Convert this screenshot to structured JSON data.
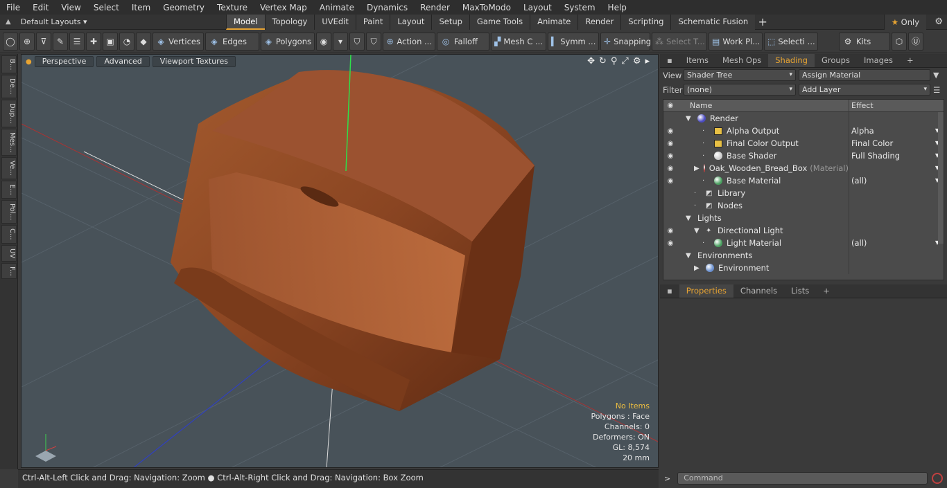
{
  "menu": [
    "File",
    "Edit",
    "View",
    "Select",
    "Item",
    "Geometry",
    "Texture",
    "Vertex Map",
    "Animate",
    "Dynamics",
    "Render",
    "MaxToModo",
    "Layout",
    "System",
    "Help"
  ],
  "layouts": {
    "label": "Default Layouts",
    "tabs": [
      "Model",
      "Topology",
      "UVEdit",
      "Paint",
      "Layout",
      "Setup",
      "Game Tools",
      "Animate",
      "Render",
      "Scripting",
      "Schematic Fusion"
    ],
    "active": "Model",
    "only": "Only"
  },
  "toolbar": {
    "vertices": "Vertices",
    "edges": "Edges",
    "polygons": "Polygons",
    "action": "Action ...",
    "falloff": "Falloff",
    "mesh": "Mesh C ...",
    "symm": "Symm ...",
    "snapping": "Snapping",
    "select_t": "Select T...",
    "workpl": "Work Pl...",
    "selecti": "Selecti ...",
    "kits": "Kits"
  },
  "lefttabs": [
    "B...",
    "De...",
    "Dup...",
    "Mes...",
    "Ve...",
    "E...",
    "Pol...",
    "C...",
    "UV",
    "F..."
  ],
  "viewport": {
    "perspective": "Perspective",
    "advanced": "Advanced",
    "textures": "Viewport Textures",
    "stats": {
      "items": "No Items",
      "polygons": "Polygons : Face",
      "channels": "Channels: 0",
      "deformers": "Deformers: ON",
      "gl": "GL: 8,574",
      "size": "20 mm"
    }
  },
  "status": "Ctrl-Alt-Left Click and Drag: Navigation: Zoom ● Ctrl-Alt-Right Click and Drag: Navigation: Box Zoom",
  "rpanel": {
    "tabs": [
      "Items",
      "Mesh Ops",
      "Shading",
      "Groups",
      "Images"
    ],
    "active": "Shading",
    "view_label": "View",
    "view_value": "Shader Tree",
    "assign": "Assign Material",
    "filter_label": "Filter",
    "filter_value": "(none)",
    "add_layer": "Add Layer",
    "col_name": "Name",
    "col_effect": "Effect",
    "rows": [
      {
        "name": "Render",
        "effect": "",
        "indent": 0,
        "eye": false,
        "icon": "render-ball",
        "exp": "▼"
      },
      {
        "name": "Alpha Output",
        "effect": "Alpha",
        "indent": 2,
        "eye": true,
        "icon": "image",
        "exp": ""
      },
      {
        "name": "Final Color Output",
        "effect": "Final Color",
        "indent": 2,
        "eye": true,
        "icon": "image",
        "exp": ""
      },
      {
        "name": "Base Shader",
        "effect": "Full Shading",
        "indent": 2,
        "eye": true,
        "icon": "shader-ball",
        "exp": ""
      },
      {
        "name": "Oak_Wooden_Bread_Box",
        "extra": "(Material)",
        "effect": "",
        "indent": 1,
        "eye": true,
        "icon": "material-ball",
        "exp": "▶"
      },
      {
        "name": "Base Material",
        "effect": "(all)",
        "indent": 2,
        "eye": true,
        "icon": "base-ball",
        "exp": ""
      },
      {
        "name": "Library",
        "effect": "",
        "indent": 1,
        "eye": false,
        "icon": "folder",
        "exp": ""
      },
      {
        "name": "Nodes",
        "effect": "",
        "indent": 1,
        "eye": false,
        "icon": "folder",
        "exp": ""
      },
      {
        "name": "Lights",
        "effect": "",
        "indent": 0,
        "eye": false,
        "icon": "",
        "exp": "▼"
      },
      {
        "name": "Directional Light",
        "effect": "",
        "indent": 1,
        "eye": true,
        "icon": "light",
        "exp": "▼"
      },
      {
        "name": "Light Material",
        "effect": "(all)",
        "indent": 2,
        "eye": true,
        "icon": "base-ball",
        "exp": ""
      },
      {
        "name": "Environments",
        "effect": "",
        "indent": 0,
        "eye": false,
        "icon": "",
        "exp": "▼"
      },
      {
        "name": "Environment",
        "effect": "",
        "indent": 1,
        "eye": false,
        "icon": "env-ball",
        "exp": "▶"
      }
    ],
    "ptabs": [
      "Properties",
      "Channels",
      "Lists"
    ],
    "pactive": "Properties",
    "command": "Command"
  }
}
